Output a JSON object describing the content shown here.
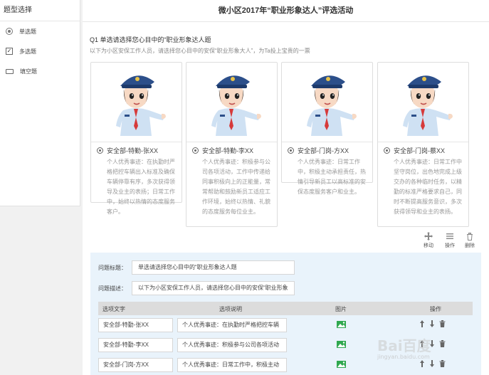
{
  "sidebar": {
    "title": "题型选择",
    "items": [
      {
        "label": "单选题",
        "icon": "radio-icon"
      },
      {
        "label": "多选题",
        "icon": "checkbox-icon"
      },
      {
        "label": "填空题",
        "icon": "input-icon"
      }
    ]
  },
  "survey": {
    "title": "微小区2017年“职业形象达人”评选活动",
    "question_title": "Q1   单选请选择您心目中的“职业形象达人题",
    "question_desc": "以下为小区安保工作人员，请选择您心目中的安保“职业形象大人”，为Ta投上宝贵的一票"
  },
  "options": [
    {
      "label": "安全部-特勤-张XX",
      "desc": "个人优秀事迹：在执勤时严格把控车辆出入标准及确保车辆停靠有序，多次获得领导及业主的表扬；日常工作中，始终以热情的态度服务客户。"
    },
    {
      "label": "安全部-特勤-李XX",
      "desc": "个人优秀事迹：积极参与公司各项活动，工作中传递给同事积极向上的正能量，常常帮助和鼓励新员工适应工作环境，始终以热情、礼貌的态度服务每位业主。"
    },
    {
      "label": "安全部-门岗-方XX",
      "desc": "个人优秀事迹：日常工作中，积极主动承担责任，热情引导新员工以高标准的安保态度服务客户和业主。"
    },
    {
      "label": "安全部-门岗-蔡XX",
      "desc": "个人优秀事迹：日常工作中坚守岗位，出色地完成上级交办的各种临时任务，以精勤的标准严格要求自己，同时不断提高服务意识，多次获得领导和业主的表扬。"
    }
  ],
  "tools": [
    {
      "label": "移动",
      "icon": "move-icon"
    },
    {
      "label": "操作",
      "icon": "menu-icon"
    },
    {
      "label": "删除",
      "icon": "trash-icon"
    }
  ],
  "editor": {
    "title_label": "问题标题：",
    "title_value": "单选请选择您心目中的“职业形象达人题",
    "desc_label": "问题描述：",
    "desc_value": "以下为小区安保工作人员，请选择您心目中的安保“职业形象",
    "columns": [
      "选项文字",
      "选项说明",
      "图片",
      "操作"
    ],
    "rows": [
      {
        "text": "安全部-特勤-张XX",
        "desc": "个人优秀事迹：在执勤时严格把控车辆"
      },
      {
        "text": "安全部-特勤-李XX",
        "desc": "个人优秀事迹：积极参与公司各项活动"
      },
      {
        "text": "安全部-门岗-方XX",
        "desc": "个人优秀事迹：日常工作中，积极主动"
      }
    ]
  },
  "watermark": {
    "main": "Bai百度",
    "sub": "jingyan.baidu.com"
  },
  "colors": {
    "editor_bg": "#e9f3fb",
    "image_icon": "#2fa84f",
    "cap": "#2c4f8a"
  }
}
